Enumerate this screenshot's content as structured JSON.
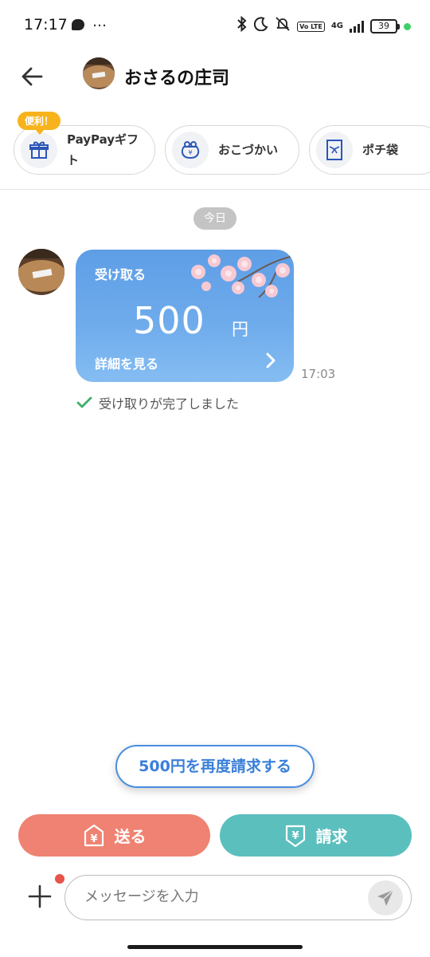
{
  "status_bar": {
    "time": "17:17",
    "overflow": "…",
    "net": "4G",
    "volte": "Vo LTE",
    "battery": "39"
  },
  "header": {
    "contact_name": "おさるの庄司"
  },
  "shortcuts": {
    "badge": "便利！",
    "items": [
      {
        "label": "PayPayギフト",
        "icon": "gift-icon"
      },
      {
        "label": "おこづかい",
        "icon": "coin-purse-icon"
      },
      {
        "label": "ポチ袋",
        "icon": "envelope-icon"
      }
    ]
  },
  "chat": {
    "date_label": "今日",
    "card": {
      "title": "受け取る",
      "amount": "500",
      "unit": "円",
      "detail_link": "詳細を見る"
    },
    "message_time": "17:03",
    "status_text": "受け取りが完了しました"
  },
  "actions": {
    "rerequest_label": "500円を再度請求する",
    "send_label": "送る",
    "request_label": "請求"
  },
  "composer": {
    "placeholder": "メッセージを入力"
  },
  "colors": {
    "send": "#ef8272",
    "request": "#5bbfbe",
    "accent_blue": "#3a7fd9",
    "badge": "#f6b31c",
    "card_blue": "#6eabec"
  }
}
